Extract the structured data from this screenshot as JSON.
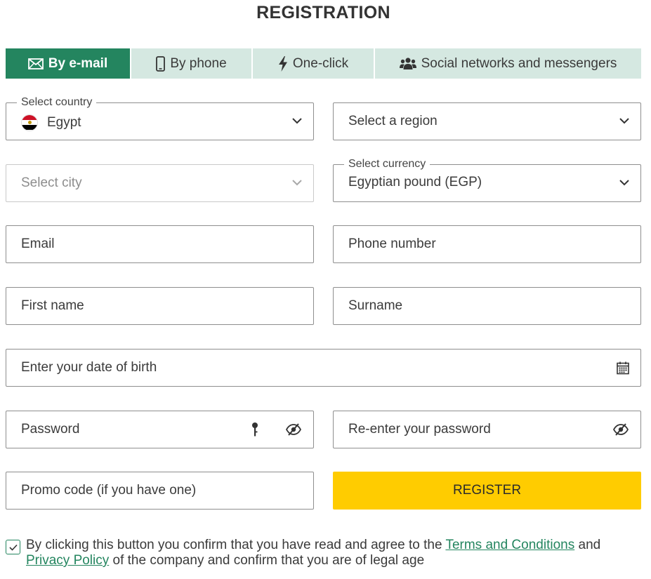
{
  "page": {
    "title": "REGISTRATION"
  },
  "tabs": [
    {
      "label": "By e-mail",
      "icon": "envelope-icon",
      "active": true
    },
    {
      "label": "By phone",
      "icon": "phone-icon",
      "active": false
    },
    {
      "label": "One-click",
      "icon": "lightning-icon",
      "active": false
    },
    {
      "label": "Social networks and messengers",
      "icon": "users-icon",
      "active": false
    }
  ],
  "form": {
    "country": {
      "label": "Select country",
      "value": "Egypt",
      "flag": "egypt-flag-icon"
    },
    "region": {
      "placeholder": "Select a region"
    },
    "city": {
      "placeholder": "Select city",
      "disabled": true
    },
    "currency": {
      "label": "Select currency",
      "value": "Egyptian pound (EGP)"
    },
    "email": {
      "placeholder": "Email"
    },
    "phone": {
      "placeholder": "Phone number"
    },
    "first_name": {
      "placeholder": "First name"
    },
    "surname": {
      "placeholder": "Surname"
    },
    "dob": {
      "placeholder": "Enter your date of birth"
    },
    "password": {
      "placeholder": "Password"
    },
    "password_repeat": {
      "placeholder": "Re-enter your password"
    },
    "promo": {
      "placeholder": "Promo code (if you have one)"
    },
    "register_label": "REGISTER"
  },
  "consent": {
    "checked": true,
    "text_before": "By clicking this button you confirm that you have read and agree to the ",
    "terms_link": "Terms and Conditions",
    "text_and": " and",
    "privacy_link": "Privacy Policy",
    "text_after": " of the company and confirm that you are of legal age"
  },
  "colors": {
    "accent": "#24855f",
    "tab_inactive": "#d5e8e1",
    "register_button": "#ffcc00",
    "border": "#8e8e8e"
  }
}
